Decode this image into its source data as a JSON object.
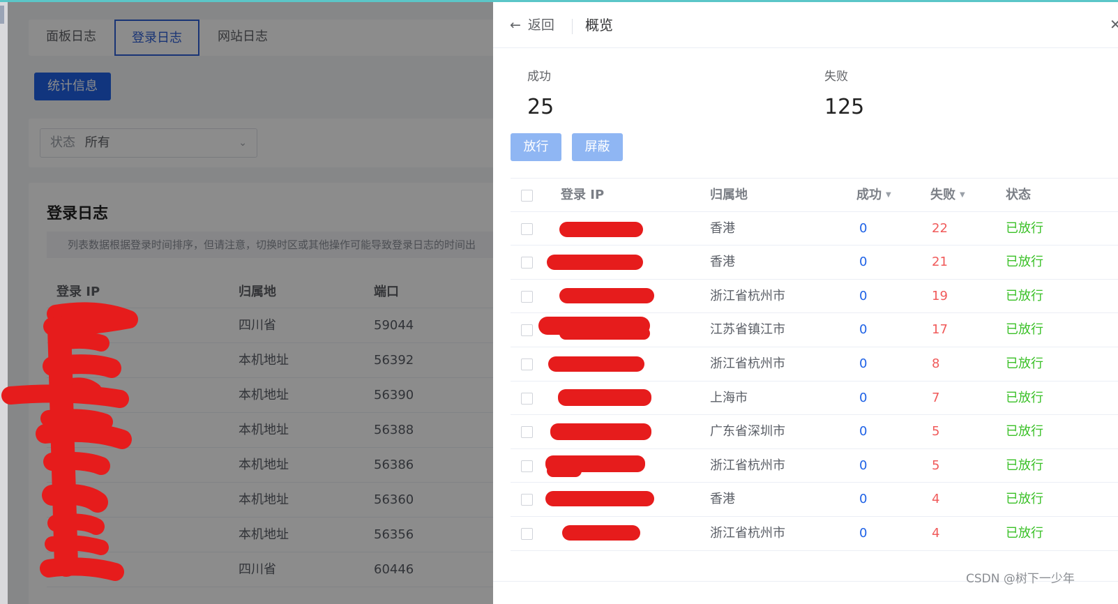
{
  "background": {
    "tabs": [
      "面板日志",
      "登录日志",
      "网站日志"
    ],
    "active_tab": "登录日志",
    "stat_button": "统计信息",
    "filter": {
      "label": "状态",
      "value": "所有"
    },
    "card_title": "登录日志",
    "notice": "列表数据根据登录时间排序，但请注意，切换时区或其他操作可能导致登录日志的时间出",
    "table": {
      "headers": [
        "登录 IP",
        "归属地",
        "端口"
      ],
      "rows": [
        {
          "location": "四川省",
          "port": "59044"
        },
        {
          "location": "本机地址",
          "port": "56392"
        },
        {
          "location": "本机地址",
          "port": "56390"
        },
        {
          "location": "本机地址",
          "port": "56388"
        },
        {
          "location": "本机地址",
          "port": "56386"
        },
        {
          "location": "本机地址",
          "port": "56360"
        },
        {
          "location": "本机地址",
          "port": "56356"
        },
        {
          "location": "四川省",
          "port": "60446"
        }
      ]
    }
  },
  "drawer": {
    "back_label": "返回",
    "title": "概览",
    "stats": {
      "success_label": "成功",
      "success_value": "25",
      "fail_label": "失败",
      "fail_value": "125"
    },
    "buttons": {
      "allow": "放行",
      "block": "屏蔽"
    },
    "table": {
      "headers": {
        "ip": "登录 IP",
        "location": "归属地",
        "success": "成功",
        "fail": "失败",
        "status": "状态"
      },
      "rows": [
        {
          "location": "香港",
          "success": "0",
          "fail": "22",
          "status": "已放行"
        },
        {
          "location": "香港",
          "success": "0",
          "fail": "21",
          "status": "已放行"
        },
        {
          "location": "浙江省杭州市",
          "success": "0",
          "fail": "19",
          "status": "已放行"
        },
        {
          "location": "江苏省镇江市",
          "success": "0",
          "fail": "17",
          "status": "已放行"
        },
        {
          "location": "浙江省杭州市",
          "success": "0",
          "fail": "8",
          "status": "已放行"
        },
        {
          "location": "上海市",
          "success": "0",
          "fail": "7",
          "status": "已放行"
        },
        {
          "location": "广东省深圳市",
          "success": "0",
          "fail": "5",
          "status": "已放行"
        },
        {
          "location": "浙江省杭州市",
          "success": "0",
          "fail": "5",
          "status": "已放行"
        },
        {
          "location": "香港",
          "success": "0",
          "fail": "4",
          "status": "已放行"
        },
        {
          "location": "浙江省杭州市",
          "success": "0",
          "fail": "4",
          "status": "已放行"
        }
      ]
    }
  },
  "watermark": "CSDN @树下一少年",
  "colors": {
    "primary": "#1f62e6",
    "success": "#39c026",
    "danger": "#f05a5a",
    "redaction": "#e61c1c",
    "accent_line": "#5bc6c8"
  }
}
